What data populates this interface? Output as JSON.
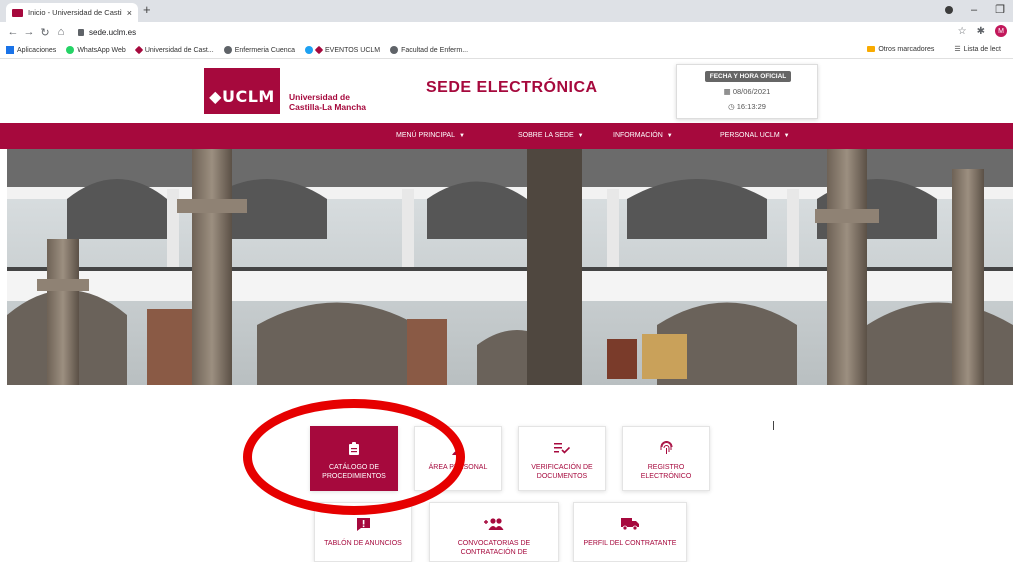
{
  "browser": {
    "tab_title": "Inicio - Universidad de Castilla-La",
    "tab_close": "×",
    "new_tab": "+",
    "url": "sede.uclm.es",
    "profile_initial": "M",
    "bookmarks": [
      {
        "label": "Aplicaciones",
        "icon": "apps-grid-icon"
      },
      {
        "label": "WhatsApp Web",
        "icon": "whatsapp-icon"
      },
      {
        "label": "Universidad de Cast...",
        "icon": "uclm-icon"
      },
      {
        "label": "Enfermeria Cuenca",
        "icon": "globe-icon"
      },
      {
        "label": "EVENTOS UCLM",
        "icon": "twitter-icon"
      },
      {
        "label": "Facultad de Enferm...",
        "icon": "globe-icon"
      }
    ],
    "bookmarks_right": [
      "Otros marcadores",
      "Lista de lect"
    ]
  },
  "header": {
    "logo_text": "UCLM",
    "uni_name_line1": "Universidad de",
    "uni_name_line2": "Castilla-La Mancha",
    "title": "SEDE ELECTRÓNICA",
    "clock_label": "FECHA Y HORA OFICIAL",
    "date": "08/06/2021",
    "time": "16:13:29"
  },
  "menu": [
    {
      "label": "MENÚ PRINCIPAL"
    },
    {
      "label": "SOBRE LA SEDE"
    },
    {
      "label": "INFORMACIÓN"
    },
    {
      "label": "PERSONAL UCLM"
    }
  ],
  "tiles": [
    {
      "line1": "CATÁLOGO DE",
      "line2": "PROCEDIMIENTOS",
      "icon": "clipboard-icon"
    },
    {
      "line1": "ÁREA PERSONAL",
      "line2": "",
      "icon": "user-icon"
    },
    {
      "line1": "VERIFICACIÓN DE",
      "line2": "DOCUMENTOS",
      "icon": "list-check-icon"
    },
    {
      "line1": "REGISTRO",
      "line2": "ELECTRÓNICO",
      "icon": "fingerprint-icon"
    },
    {
      "line1": "TABLÓN DE ANUNCIOS",
      "line2": "",
      "icon": "alert-message-icon"
    },
    {
      "line1": "CONVOCATORIAS DE",
      "line2": "CONTRATACIÓN DE",
      "icon": "users-add-icon"
    },
    {
      "line1": "PERFIL DEL CONTRATANTE",
      "line2": "",
      "icon": "truck-icon"
    }
  ],
  "colors": {
    "brand": "#a6093d",
    "highlight": "#e60000"
  }
}
